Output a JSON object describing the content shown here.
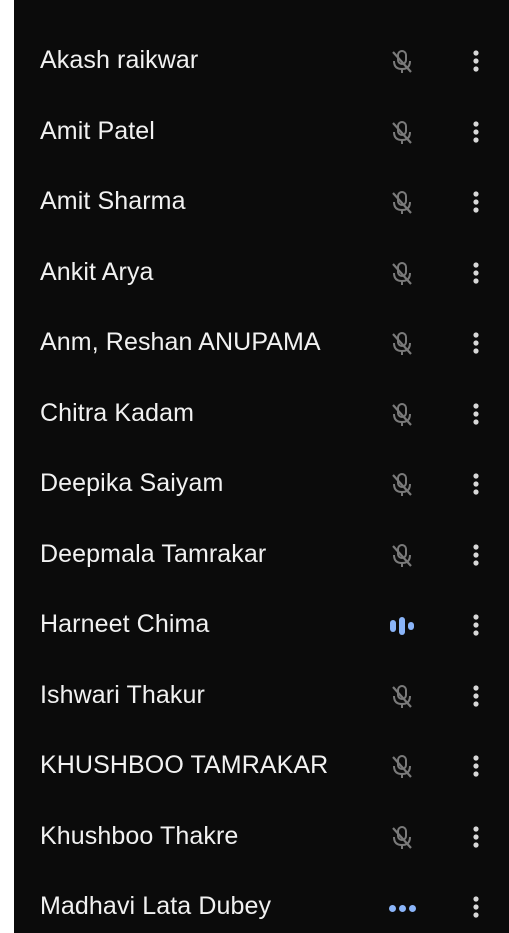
{
  "participants": [
    {
      "name": "Akash raikwar",
      "status_icon": "mic-off-icon"
    },
    {
      "name": "Amit Patel",
      "status_icon": "mic-off-icon"
    },
    {
      "name": "Amit Sharma",
      "status_icon": "mic-off-icon"
    },
    {
      "name": "Ankit Arya",
      "status_icon": "mic-off-icon"
    },
    {
      "name": "Anm, Reshan ANUPAMA",
      "status_icon": "mic-off-icon"
    },
    {
      "name": "Chitra Kadam",
      "status_icon": "mic-off-icon"
    },
    {
      "name": "Deepika Saiyam",
      "status_icon": "mic-off-icon"
    },
    {
      "name": "Deepmala Tamrakar",
      "status_icon": "mic-off-icon"
    },
    {
      "name": "Harneet Chima",
      "status_icon": "speaking-icon"
    },
    {
      "name": "Ishwari Thakur",
      "status_icon": "mic-off-icon"
    },
    {
      "name": "KHUSHBOO TAMRAKAR",
      "status_icon": "mic-off-icon"
    },
    {
      "name": "Khushboo Thakre",
      "status_icon": "mic-off-icon"
    },
    {
      "name": "Madhavi Lata Dubey",
      "status_icon": "mic-on-dots-icon"
    }
  ],
  "colors": {
    "background": "#0b0b0b",
    "text": "#f1f1f1",
    "muted_icon": "#7a7a7a",
    "accent": "#8ab4f8"
  },
  "icons": {
    "more": "more-vert-icon"
  }
}
